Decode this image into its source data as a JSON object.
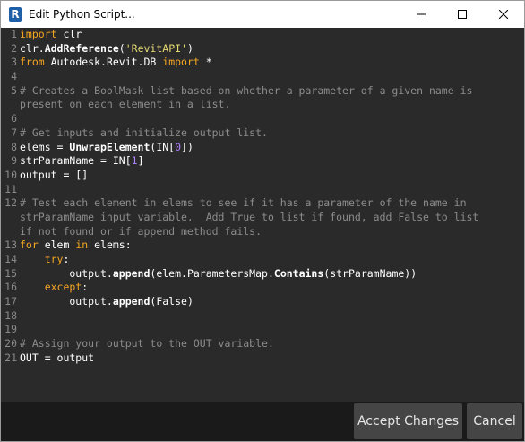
{
  "window": {
    "title": "Edit Python Script...",
    "app_icon_letter": "R"
  },
  "editor": {
    "lines": [
      {
        "n": "1",
        "tokens": [
          {
            "t": "import",
            "c": "kw"
          },
          {
            "t": " clr",
            "c": ""
          }
        ]
      },
      {
        "n": "2",
        "tokens": [
          {
            "t": "clr.",
            "c": ""
          },
          {
            "t": "AddReference",
            "c": "fn"
          },
          {
            "t": "(",
            "c": ""
          },
          {
            "t": "'RevitAPI'",
            "c": "str"
          },
          {
            "t": ")",
            "c": ""
          }
        ]
      },
      {
        "n": "3",
        "tokens": [
          {
            "t": "from",
            "c": "kw"
          },
          {
            "t": " Autodesk.Revit.DB ",
            "c": ""
          },
          {
            "t": "import",
            "c": "kw"
          },
          {
            "t": " *",
            "c": ""
          }
        ]
      },
      {
        "n": "4",
        "tokens": []
      },
      {
        "n": "5",
        "tokens": [
          {
            "t": "# Creates a BoolMask list based on whether a parameter of a given name is",
            "c": "cmt"
          }
        ]
      },
      {
        "n": "",
        "tokens": [
          {
            "t": "present on each element in a list.",
            "c": "cmt"
          }
        ]
      },
      {
        "n": "6",
        "tokens": []
      },
      {
        "n": "7",
        "tokens": [
          {
            "t": "# Get inputs and initialize output list.",
            "c": "cmt"
          }
        ]
      },
      {
        "n": "8",
        "tokens": [
          {
            "t": "elems = ",
            "c": ""
          },
          {
            "t": "UnwrapElement",
            "c": "fn"
          },
          {
            "t": "(IN[",
            "c": ""
          },
          {
            "t": "0",
            "c": "num"
          },
          {
            "t": "])",
            "c": ""
          }
        ]
      },
      {
        "n": "9",
        "tokens": [
          {
            "t": "strParamName = IN[",
            "c": ""
          },
          {
            "t": "1",
            "c": "num"
          },
          {
            "t": "]",
            "c": ""
          }
        ]
      },
      {
        "n": "10",
        "tokens": [
          {
            "t": "output = []",
            "c": ""
          }
        ]
      },
      {
        "n": "11",
        "tokens": []
      },
      {
        "n": "12",
        "tokens": [
          {
            "t": "# Test each element in elems to see if it has a parameter of the name in",
            "c": "cmt"
          }
        ]
      },
      {
        "n": "",
        "tokens": [
          {
            "t": "strParamName input variable.  Add True to list if found, add False to list",
            "c": "cmt"
          }
        ]
      },
      {
        "n": "",
        "tokens": [
          {
            "t": "if not found or if append method fails.",
            "c": "cmt"
          }
        ]
      },
      {
        "n": "13",
        "tokens": [
          {
            "t": "for",
            "c": "kw"
          },
          {
            "t": " elem ",
            "c": ""
          },
          {
            "t": "in",
            "c": "kw"
          },
          {
            "t": " elems:",
            "c": ""
          }
        ]
      },
      {
        "n": "14",
        "tokens": [
          {
            "t": "    ",
            "c": ""
          },
          {
            "t": "try",
            "c": "kw"
          },
          {
            "t": ":",
            "c": ""
          }
        ]
      },
      {
        "n": "15",
        "tokens": [
          {
            "t": "        output.",
            "c": ""
          },
          {
            "t": "append",
            "c": "fn"
          },
          {
            "t": "(elem.ParametersMap.",
            "c": ""
          },
          {
            "t": "Contains",
            "c": "fn"
          },
          {
            "t": "(strParamName))",
            "c": ""
          }
        ]
      },
      {
        "n": "16",
        "tokens": [
          {
            "t": "    ",
            "c": ""
          },
          {
            "t": "except",
            "c": "kw"
          },
          {
            "t": ":",
            "c": ""
          }
        ]
      },
      {
        "n": "17",
        "tokens": [
          {
            "t": "        output.",
            "c": ""
          },
          {
            "t": "append",
            "c": "fn"
          },
          {
            "t": "(False)",
            "c": ""
          }
        ]
      },
      {
        "n": "18",
        "tokens": []
      },
      {
        "n": "19",
        "tokens": []
      },
      {
        "n": "20",
        "tokens": [
          {
            "t": "# Assign your output to the OUT variable.",
            "c": "cmt"
          }
        ]
      },
      {
        "n": "21",
        "tokens": [
          {
            "t": "OUT = output",
            "c": ""
          }
        ]
      }
    ]
  },
  "footer": {
    "accept_label": "Accept Changes",
    "cancel_label": "Cancel"
  },
  "colors": {
    "keyword": "#f5a623",
    "string": "#e6db74",
    "number": "#ae81ff",
    "comment": "#8c8c8c",
    "editor_bg": "#2a2a2a"
  }
}
